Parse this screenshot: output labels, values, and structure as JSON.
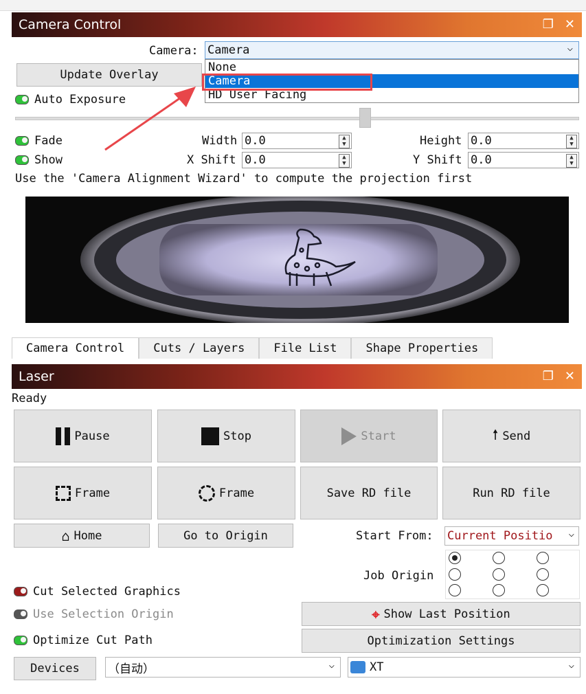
{
  "camera_panel": {
    "title": "Camera Control",
    "camera_label": "Camera:",
    "camera_value": "Camera",
    "camera_options": [
      "None",
      "Camera",
      "HD User Facing"
    ],
    "update_overlay": "Update Overlay",
    "auto_exposure": "Auto Exposure",
    "fade": "Fade",
    "show": "Show",
    "width_label": "Width",
    "width_value": "0.0",
    "height_label": "Height",
    "height_value": "0.0",
    "xshift_label": "X Shift",
    "xshift_value": "0.0",
    "yshift_label": "Y Shift",
    "yshift_value": "0.0",
    "hint": "Use the 'Camera Alignment Wizard' to compute the projection first"
  },
  "tabs": [
    "Camera Control",
    "Cuts / Layers",
    "File List",
    "Shape Properties"
  ],
  "laser_panel": {
    "title": "Laser",
    "status": "Ready",
    "pause": "Pause",
    "stop": "Stop",
    "start": "Start",
    "send": "Send",
    "frame_rect": "Frame",
    "frame_circle": "Frame",
    "save_rd": "Save RD file",
    "run_rd": "Run RD file",
    "home": "Home",
    "go_origin": "Go to Origin",
    "start_from_label": "Start From:",
    "start_from_value": "Current Positio",
    "job_origin_label": "Job Origin",
    "cut_selected": "Cut Selected Graphics",
    "use_selection_origin": "Use Selection Origin",
    "optimize_cut": "Optimize Cut Path",
    "show_last_position": "Show Last Position",
    "optimization_settings": "Optimization Settings",
    "devices": "Devices",
    "port_value": "（自动）",
    "device_value": "XT"
  },
  "colors": {
    "accent_select": "#0a74d8",
    "annotation": "#e8464a",
    "led_on": "#2fc23a",
    "start_from_text": "#a0171b"
  }
}
